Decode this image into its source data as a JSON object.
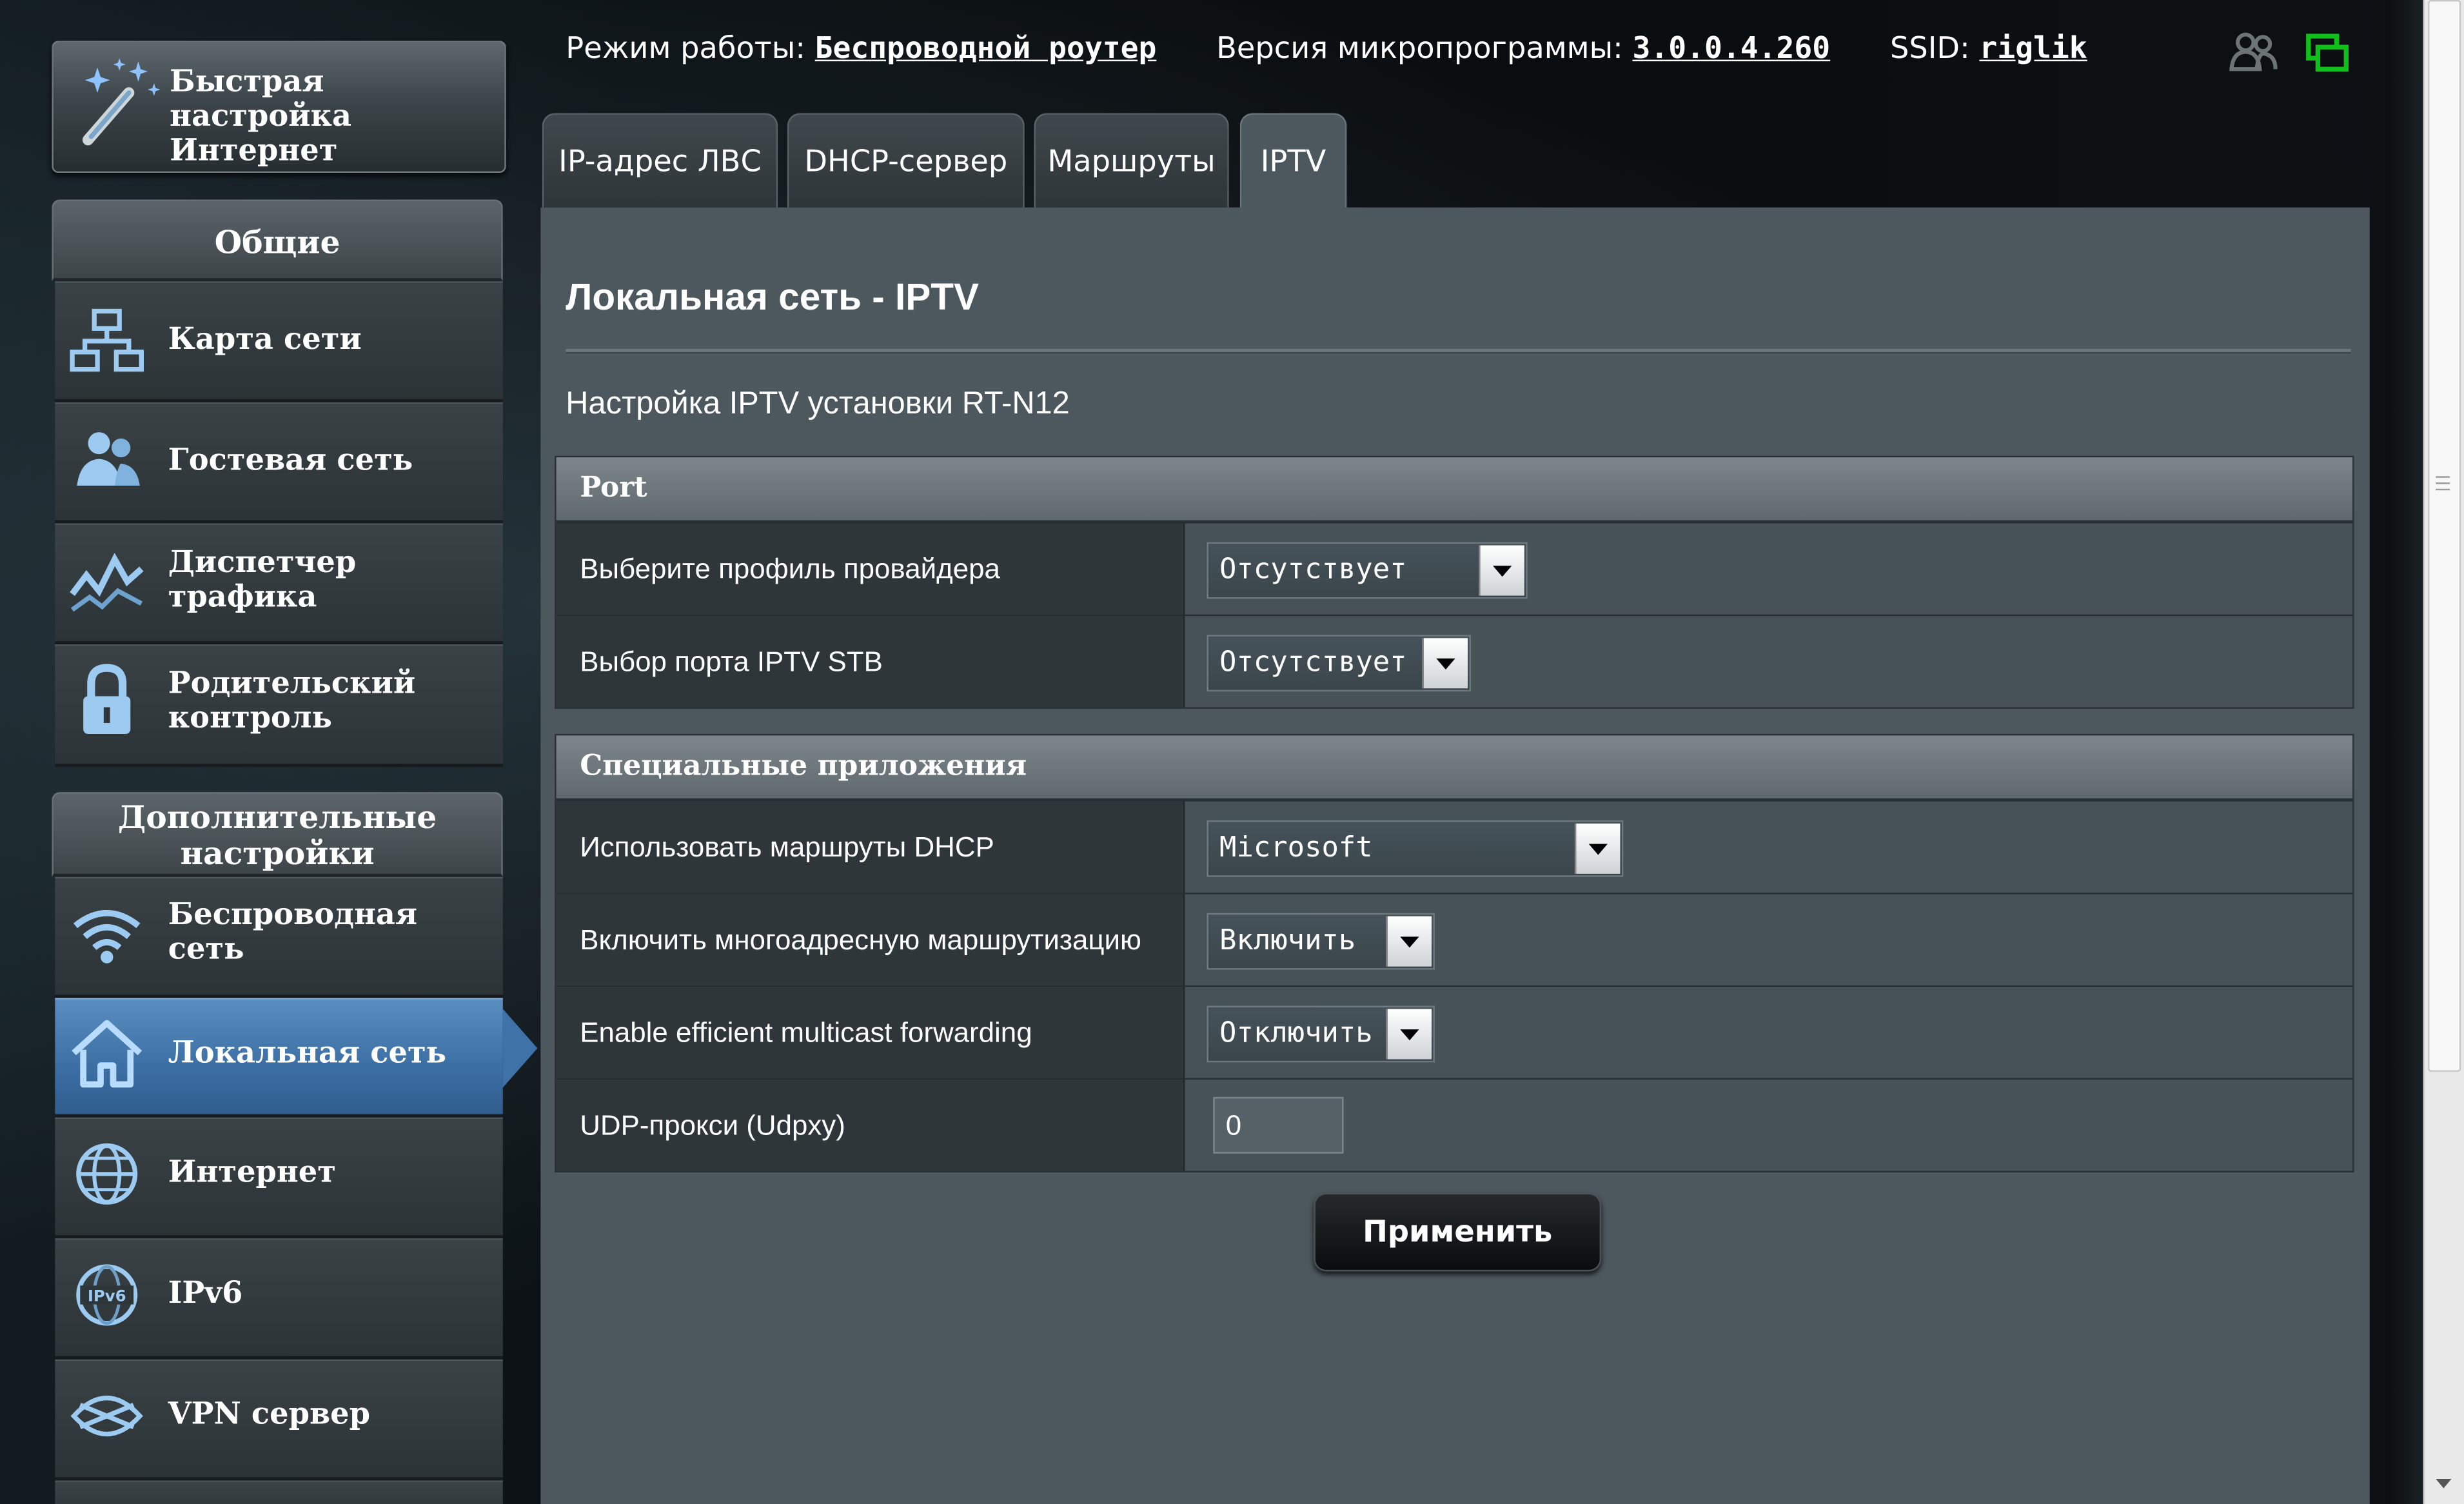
{
  "quick_setup": {
    "label": "Быстрая настройка Интернет"
  },
  "sidebar": {
    "general_header": "Общие",
    "general_items": [
      {
        "label": "Карта сети",
        "icon": "network-map-icon"
      },
      {
        "label": "Гостевая сеть",
        "icon": "guest-network-icon"
      },
      {
        "label": "Диспетчер трафика",
        "icon": "traffic-manager-icon"
      },
      {
        "label": "Родительский контроль",
        "icon": "lock-icon"
      }
    ],
    "advanced_header": "Дополнительные настройки",
    "advanced_items": [
      {
        "label": "Беспроводная сеть",
        "icon": "wifi-icon"
      },
      {
        "label": "Локальная сеть",
        "icon": "home-icon",
        "active": true
      },
      {
        "label": "Интернет",
        "icon": "globe-icon"
      },
      {
        "label": "IPv6",
        "icon": "ipv6-globe-icon"
      },
      {
        "label": "VPN сервер",
        "icon": "vpn-icon"
      }
    ]
  },
  "topbar": {
    "mode_label": "Режим работы:",
    "mode_value": "Беспроводной роутер",
    "firmware_label": "Версия микропрограммы:",
    "firmware_value": "3.0.0.4.260",
    "ssid_label": "SSID:",
    "ssid_value": "riglik"
  },
  "tabs": [
    {
      "label": "IP-адрес ЛВС"
    },
    {
      "label": "DHCP-сервер"
    },
    {
      "label": "Маршруты"
    },
    {
      "label": "IPTV",
      "active": true
    }
  ],
  "main": {
    "title": "Локальная сеть - IPTV",
    "description": "Настройка IPTV установки RT-N12",
    "port_section": {
      "header": "Port",
      "rows": [
        {
          "label": "Выберите профиль провайдера",
          "value": "Отсутствует"
        },
        {
          "label": "Выбор порта IPTV STB",
          "value": "Отсутствует"
        }
      ]
    },
    "special_section": {
      "header": "Специальные приложения",
      "rows": [
        {
          "label": "Использовать маршруты DHCP",
          "value": "Microsoft"
        },
        {
          "label": "Включить многоадресную маршрутизацию",
          "value": "Включить"
        },
        {
          "label": "Enable efficient multicast forwarding",
          "value": "Отключить"
        },
        {
          "label": "UDP-прокси (Udpxy)",
          "value": "0"
        }
      ]
    },
    "apply_label": "Применить"
  },
  "colors": {
    "accent": "#3b6ea3",
    "panel": "#4d585e",
    "dark_bg": "#0a0d0f"
  }
}
